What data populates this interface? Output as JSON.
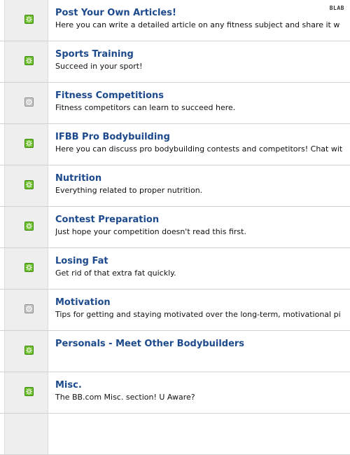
{
  "watermark": "BLAB",
  "forums": [
    {
      "title": "Post Your Own Articles!",
      "description": "Here you can write a detailed article on any fitness subject and share it w",
      "status": "new"
    },
    {
      "title": "Sports Training",
      "description": "Succeed in your sport!",
      "status": "new"
    },
    {
      "title": "Fitness Competitions",
      "description": "Fitness competitors can learn to succeed here.",
      "status": "old"
    },
    {
      "title": "IFBB Pro Bodybuilding",
      "description": "Here you can discuss pro bodybuilding contests and competitors! Chat wit",
      "status": "new"
    },
    {
      "title": "Nutrition",
      "description": "Everything related to proper nutrition.",
      "status": "new"
    },
    {
      "title": "Contest Preparation",
      "description": "Just hope your competition doesn't read this first.",
      "status": "new"
    },
    {
      "title": "Losing Fat",
      "description": "Get rid of that extra fat quickly.",
      "status": "new"
    },
    {
      "title": "Motivation",
      "description": "Tips for getting and staying motivated over the long-term, motivational pi",
      "status": "old"
    },
    {
      "title": "Personals - Meet Other Bodybuilders",
      "description": "",
      "status": "new"
    },
    {
      "title": "Misc.",
      "description": "The BB.com Misc. section! U Aware?",
      "status": "new"
    }
  ],
  "colors": {
    "new_icon": "#6cc02a",
    "old_icon": "#c6c6c6",
    "title_link": "#1d4a8c"
  }
}
